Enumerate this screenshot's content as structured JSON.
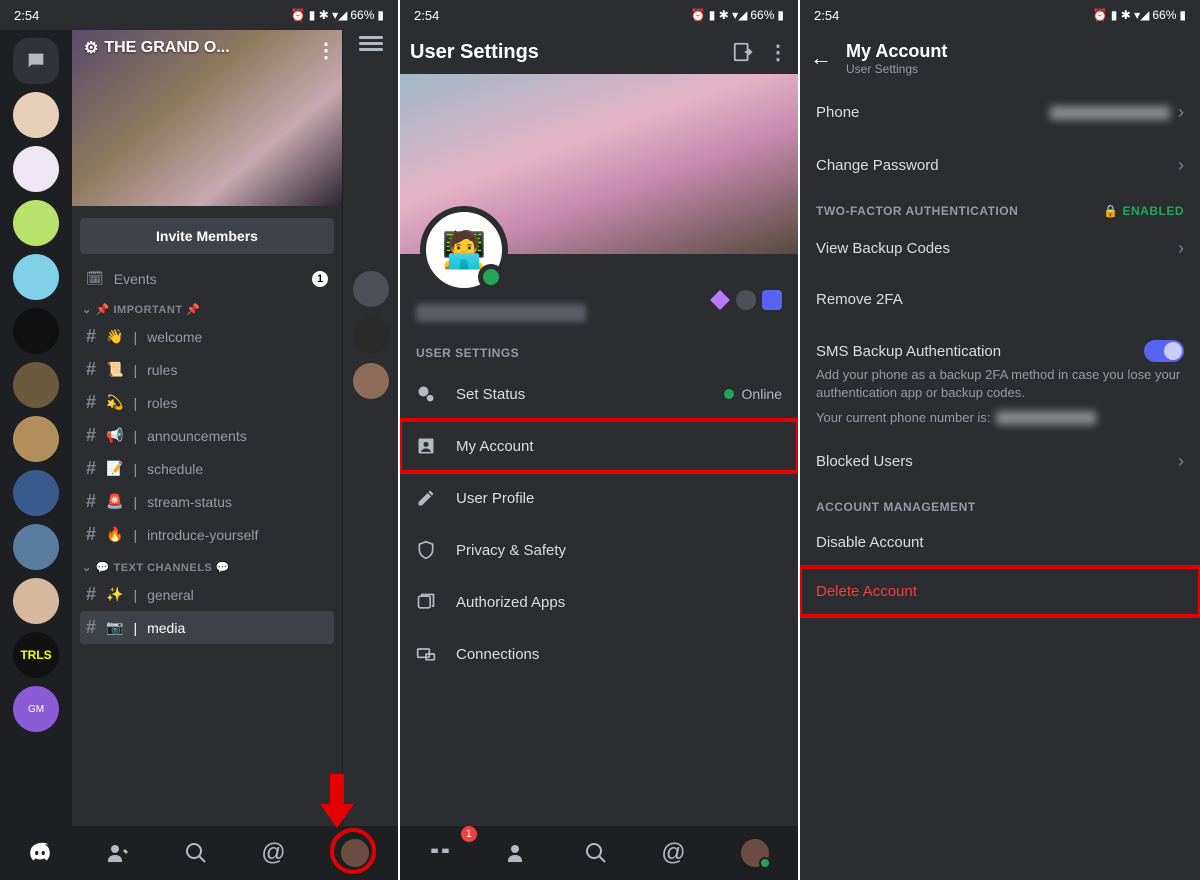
{
  "statusbar": {
    "time": "2:54",
    "battery": "66%",
    "icons": [
      "alarm",
      "vibrate",
      "bt",
      "wifi",
      "signal",
      "battery"
    ]
  },
  "screen1": {
    "server_title": "THE GRAND O...",
    "invite": "Invite Members",
    "events": {
      "label": "Events",
      "badge": "1"
    },
    "cats": [
      {
        "label": "📌 IMPORTANT 📌",
        "channels": [
          {
            "emoji": "👋",
            "name": "welcome"
          },
          {
            "emoji": "📜",
            "name": "rules"
          },
          {
            "emoji": "💫",
            "name": "roles"
          },
          {
            "emoji": "📢",
            "name": "announcements"
          },
          {
            "emoji": "📝",
            "name": "schedule"
          },
          {
            "emoji": "🚨",
            "name": "stream-status"
          },
          {
            "emoji": "🔥",
            "name": "introduce-yourself"
          }
        ]
      },
      {
        "label": "💬 TEXT CHANNELS 💬",
        "channels": [
          {
            "emoji": "✨",
            "name": "general"
          },
          {
            "emoji": "📷",
            "name": "media",
            "selected": true
          }
        ]
      }
    ],
    "bottomnav": [
      "discord",
      "friends",
      "search",
      "mentions",
      "profile"
    ]
  },
  "screen2": {
    "title": "User Settings",
    "section": "USER SETTINGS",
    "rows": [
      {
        "icon": "status",
        "label": "Set Status",
        "rlabel": "Online",
        "dot": true
      },
      {
        "icon": "account",
        "label": "My Account",
        "highlight": true
      },
      {
        "icon": "profile",
        "label": "User Profile"
      },
      {
        "icon": "privacy",
        "label": "Privacy & Safety"
      },
      {
        "icon": "apps",
        "label": "Authorized Apps"
      },
      {
        "icon": "connections",
        "label": "Connections"
      }
    ],
    "nav_badge": "1"
  },
  "screen3": {
    "title": "My Account",
    "subtitle": "User Settings",
    "rows1": [
      {
        "label": "Phone",
        "chevron": true,
        "blur": true
      },
      {
        "label": "Change Password",
        "chevron": true
      }
    ],
    "twofa": {
      "header": "TWO-FACTOR AUTHENTICATION",
      "status": "ENABLED"
    },
    "rows2": [
      {
        "label": "View Backup Codes",
        "chevron": true
      },
      {
        "label": "Remove 2FA"
      }
    ],
    "sms": {
      "label": "SMS Backup Authentication",
      "desc": "Add your phone as a backup 2FA method in case you lose your authentication app or backup codes.",
      "phone_prefix": "Your current phone number is:"
    },
    "rows3": [
      {
        "label": "Blocked Users",
        "chevron": true
      }
    ],
    "mgmt": {
      "header": "ACCOUNT MANAGEMENT",
      "rows": [
        {
          "label": "Disable Account"
        },
        {
          "label": "Delete Account",
          "danger": true,
          "highlight": true
        }
      ]
    }
  }
}
